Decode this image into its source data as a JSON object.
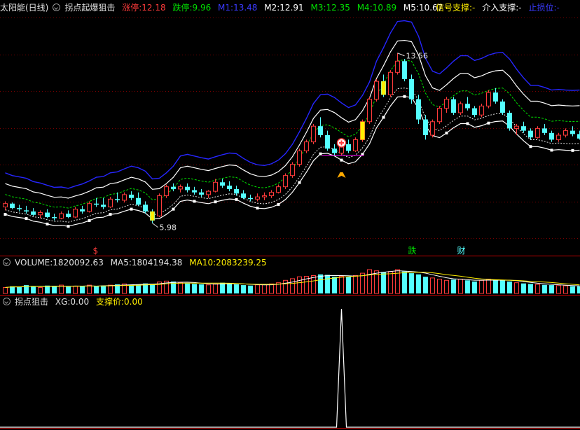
{
  "main_header": {
    "stock_name": "太阳能(日线)",
    "indicator_name": "拐点起爆狙击",
    "limit_up_label": "涨停:",
    "limit_up_value": "12.18",
    "limit_down_label": "跌停:",
    "limit_down_value": "9.96",
    "m1_label": "M1:",
    "m1_value": "13.48",
    "m2_label": "M2:",
    "m2_value": "12.91",
    "m3_label": "M3:",
    "m3_value": "12.35",
    "m4_label": "M4:",
    "m4_value": "10.89",
    "m5_label": "M5:",
    "m5_value": "10.67",
    "signal_label": "信号支撑:",
    "signal_value": "-",
    "entry_label": "介入支撑:",
    "entry_value": "-",
    "stop_label": "止损位:",
    "stop_value": "-"
  },
  "volume_header": {
    "volume_label": "VOLUME:",
    "volume_value": "1820092.63",
    "ma5_label": "MA5:",
    "ma5_value": "1804194.38",
    "ma10_label": "MA10:",
    "ma10_value": "2083239.25"
  },
  "sub_header": {
    "indicator_name": "拐点狙击",
    "xg_label": "XG:",
    "xg_value": "0.00",
    "support_label": "支撑价:",
    "support_value": "0.00"
  },
  "colors": {
    "up": "#ff3b3b",
    "down": "#54ffff",
    "band_blue": "#2626ff",
    "band_white": "#ffffff",
    "dash_green": "#00e000",
    "dash_white": "#e8e8e8",
    "signal_yellow": "#ffee00",
    "ma5_line": "#ffffff",
    "ma10_line": "#ffee00",
    "grid": "#7a0000",
    "highlight": "#ff00ff"
  },
  "chart_data": {
    "type": "candlestick",
    "price_ylim": [
      5.0,
      15.3
    ],
    "max_price_label": "13.56",
    "min_price_label": "5.98",
    "candles": [
      [
        0,
        6.7,
        6.95,
        6.55,
        6.85
      ],
      [
        1,
        6.85,
        6.9,
        6.6,
        6.65
      ],
      [
        2,
        6.65,
        6.8,
        6.5,
        6.6
      ],
      [
        3,
        6.55,
        6.75,
        6.4,
        6.5
      ],
      [
        4,
        6.5,
        6.65,
        6.3,
        6.35
      ],
      [
        5,
        6.35,
        6.55,
        6.2,
        6.45
      ],
      [
        6,
        6.45,
        6.6,
        6.2,
        6.25
      ],
      [
        7,
        6.25,
        6.4,
        6.1,
        6.2
      ],
      [
        8,
        6.2,
        6.5,
        6.15,
        6.4
      ],
      [
        9,
        6.4,
        6.55,
        6.2,
        6.25
      ],
      [
        10,
        6.25,
        6.7,
        6.2,
        6.6
      ],
      [
        11,
        6.6,
        6.75,
        6.4,
        6.5
      ],
      [
        12,
        6.5,
        6.95,
        6.45,
        6.85
      ],
      [
        13,
        6.85,
        7.1,
        6.7,
        6.8
      ],
      [
        14,
        6.8,
        7.1,
        6.6,
        6.7
      ],
      [
        15,
        6.7,
        7.15,
        6.65,
        7.05
      ],
      [
        16,
        7.05,
        7.35,
        6.9,
        7.0
      ],
      [
        17,
        7.0,
        7.35,
        6.9,
        7.25
      ],
      [
        18,
        7.25,
        7.4,
        7.0,
        7.1
      ],
      [
        19,
        7.1,
        7.35,
        6.75,
        6.8
      ],
      [
        20,
        6.8,
        6.95,
        6.4,
        6.5
      ],
      [
        21,
        6.5,
        6.6,
        5.98,
        6.1
      ],
      [
        22,
        6.3,
        7.3,
        6.25,
        7.2
      ],
      [
        23,
        7.2,
        7.7,
        7.1,
        7.6
      ],
      [
        24,
        7.6,
        7.75,
        7.4,
        7.5
      ],
      [
        25,
        7.5,
        7.7,
        7.35,
        7.6
      ],
      [
        26,
        7.6,
        7.75,
        7.35,
        7.45
      ],
      [
        27,
        7.45,
        7.6,
        7.25,
        7.35
      ],
      [
        28,
        7.35,
        7.5,
        7.15,
        7.25
      ],
      [
        29,
        7.25,
        7.45,
        7.1,
        7.4
      ],
      [
        30,
        7.4,
        7.95,
        7.35,
        7.8
      ],
      [
        31,
        7.8,
        7.95,
        7.55,
        7.65
      ],
      [
        32,
        7.65,
        7.85,
        7.4,
        7.5
      ],
      [
        33,
        7.5,
        7.65,
        7.2,
        7.3
      ],
      [
        34,
        7.3,
        7.45,
        7.05,
        7.1
      ],
      [
        35,
        7.1,
        7.25,
        6.95,
        7.05
      ],
      [
        36,
        7.05,
        7.3,
        6.95,
        7.15
      ],
      [
        37,
        7.15,
        7.35,
        7.0,
        7.2
      ],
      [
        38,
        7.2,
        7.45,
        7.1,
        7.35
      ],
      [
        39,
        7.35,
        7.7,
        7.3,
        7.6
      ],
      [
        40,
        7.6,
        8.2,
        7.5,
        8.1
      ],
      [
        41,
        8.1,
        8.7,
        8.0,
        8.6
      ],
      [
        42,
        8.6,
        9.3,
        8.5,
        9.2
      ],
      [
        43,
        9.2,
        9.7,
        9.1,
        9.6
      ],
      [
        44,
        9.6,
        10.4,
        9.5,
        10.3
      ],
      [
        45,
        10.3,
        10.7,
        9.8,
        9.9
      ],
      [
        46,
        9.9,
        10.1,
        9.2,
        9.3
      ],
      [
        47,
        9.3,
        9.5,
        9.0,
        9.1
      ],
      [
        48,
        9.1,
        9.6,
        9.0,
        9.5
      ],
      [
        49,
        9.5,
        9.7,
        9.1,
        9.2
      ],
      [
        50,
        9.2,
        9.8,
        9.15,
        9.7
      ],
      [
        51,
        9.7,
        10.6,
        9.6,
        10.5
      ],
      [
        52,
        10.5,
        11.6,
        10.4,
        11.5
      ],
      [
        53,
        11.5,
        12.4,
        11.4,
        12.3
      ],
      [
        54,
        12.3,
        12.6,
        11.6,
        11.7
      ],
      [
        55,
        11.7,
        12.8,
        11.6,
        12.7
      ],
      [
        56,
        12.7,
        13.56,
        12.6,
        13.2
      ],
      [
        57,
        13.2,
        13.3,
        12.3,
        12.4
      ],
      [
        58,
        12.4,
        12.6,
        11.3,
        11.5
      ],
      [
        59,
        11.5,
        11.7,
        10.4,
        10.6
      ],
      [
        60,
        10.6,
        10.8,
        9.7,
        9.9
      ],
      [
        61,
        9.9,
        10.6,
        9.8,
        10.5
      ],
      [
        62,
        10.5,
        11.2,
        10.4,
        11.1
      ],
      [
        63,
        11.1,
        11.6,
        10.9,
        11.5
      ],
      [
        64,
        11.5,
        11.6,
        10.8,
        10.9
      ],
      [
        65,
        10.9,
        11.4,
        10.8,
        11.3
      ],
      [
        66,
        11.3,
        11.6,
        11.0,
        11.1
      ],
      [
        67,
        11.1,
        11.2,
        10.7,
        10.8
      ],
      [
        68,
        10.8,
        11.3,
        10.7,
        11.2
      ],
      [
        69,
        11.2,
        11.9,
        11.1,
        11.8
      ],
      [
        70,
        11.8,
        12.0,
        11.3,
        11.4
      ],
      [
        71,
        11.4,
        11.5,
        10.8,
        10.9
      ],
      [
        72,
        10.9,
        11.0,
        10.1,
        10.2
      ],
      [
        73,
        10.2,
        10.4,
        9.9,
        10.3
      ],
      [
        74,
        10.3,
        10.5,
        10.0,
        10.1
      ],
      [
        75,
        10.1,
        10.2,
        9.7,
        9.8
      ],
      [
        76,
        9.8,
        10.3,
        9.75,
        10.2
      ],
      [
        77,
        10.2,
        10.4,
        9.9,
        10.0
      ],
      [
        78,
        10.0,
        10.1,
        9.6,
        9.7
      ],
      [
        79,
        9.7,
        10.0,
        9.6,
        9.9
      ],
      [
        80,
        9.9,
        10.2,
        9.8,
        10.1
      ],
      [
        81,
        10.1,
        10.3,
        9.85,
        9.95
      ],
      [
        82,
        9.95,
        10.1,
        9.7,
        9.75
      ]
    ],
    "volume_ratios": [
      0.25,
      0.3,
      0.28,
      0.35,
      0.3,
      0.25,
      0.33,
      0.3,
      0.35,
      0.28,
      0.3,
      0.32,
      0.35,
      0.3,
      0.33,
      0.35,
      0.38,
      0.4,
      0.36,
      0.38,
      0.42,
      0.4,
      0.48,
      0.52,
      0.5,
      0.45,
      0.42,
      0.4,
      0.38,
      0.36,
      0.4,
      0.45,
      0.42,
      0.38,
      0.35,
      0.33,
      0.36,
      0.38,
      0.4,
      0.45,
      0.55,
      0.62,
      0.7,
      0.72,
      0.75,
      0.8,
      0.78,
      0.7,
      0.72,
      0.7,
      0.75,
      0.85,
      1.0,
      0.95,
      0.9,
      0.92,
      1.0,
      0.92,
      0.85,
      0.8,
      0.7,
      0.65,
      0.6,
      0.55,
      0.58,
      0.6,
      0.55,
      0.5,
      0.55,
      0.6,
      0.58,
      0.55,
      0.5,
      0.45,
      0.42,
      0.4,
      0.38,
      0.36,
      0.35,
      0.33,
      0.32,
      0.3,
      0.3
    ],
    "xg_signal_index": 48,
    "markers": [
      {
        "index": 13,
        "text": "$",
        "color": "#ff3b3b"
      },
      {
        "index": 58,
        "text": "跌",
        "color": "#00e000"
      },
      {
        "index": 65,
        "text": "财",
        "color": "#54ffff"
      }
    ]
  }
}
